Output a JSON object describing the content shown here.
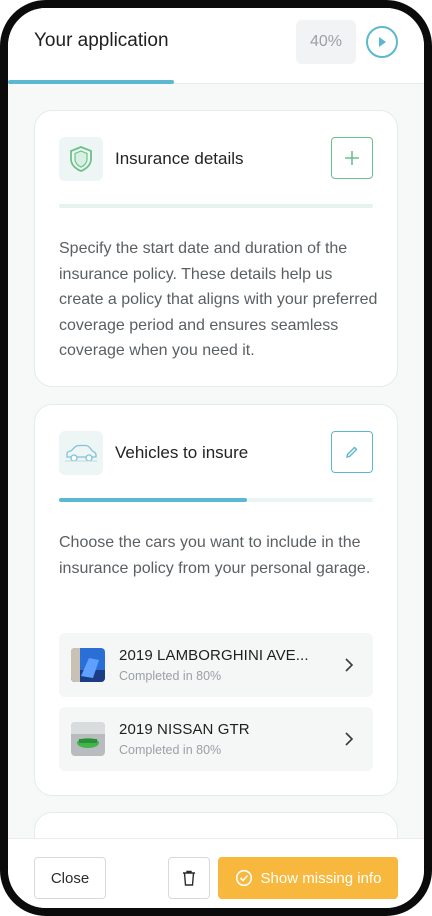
{
  "header": {
    "title": "Your application",
    "progress_label": "40%",
    "progress_fraction": 0.4
  },
  "cards": [
    {
      "title": "Insurance details",
      "icon": "shield-icon",
      "action_icon": "plus-icon",
      "progress_fraction": 0,
      "description": "Specify the start date and duration of the insurance policy. These details help us create a policy that aligns with your preferred coverage period and ensures seamless coverage when you need it."
    },
    {
      "title": "Vehicles to insure",
      "icon": "car-icon",
      "action_icon": "pencil-icon",
      "progress_fraction": 0.6,
      "description": "Choose the cars you want to include in the insurance policy from your personal garage.",
      "vehicles": [
        {
          "name": "2019 LAMBORGHINI AVE...",
          "status": "Completed in 80%"
        },
        {
          "name": "2019 NISSAN GTR",
          "status": "Completed in 80%"
        }
      ]
    }
  ],
  "footer": {
    "close_label": "Close",
    "missing_label": "Show missing info"
  },
  "colors": {
    "accent": "#5bb8d0",
    "green": "#6cc08a",
    "warning": "#f7b83d"
  }
}
